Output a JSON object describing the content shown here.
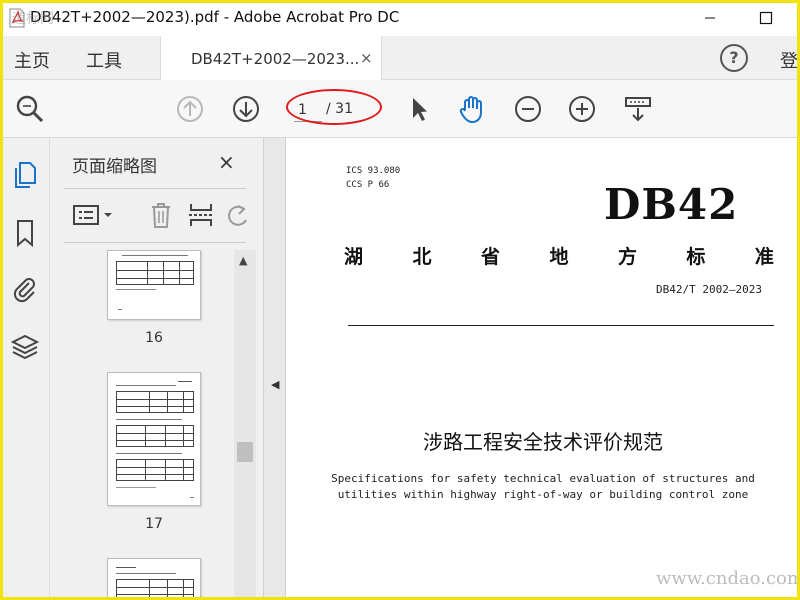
{
  "window": {
    "title": "DB42T+2002—2023).pdf - Adobe Acrobat Pro DC",
    "watermark_top": "道标网"
  },
  "tabbar": {
    "home": "主页",
    "tools": "工具",
    "doc_tab": "DB42T+2002—2023...",
    "close": "×",
    "help": "?",
    "signin": "登"
  },
  "toolbar": {
    "page_current": "1",
    "page_total": "/ 31",
    "icons": [
      "search-zoom-icon",
      "arrow-up-circle-icon",
      "arrow-down-circle-icon",
      "select-pointer-icon",
      "hand-tool-icon",
      "zoom-out-icon",
      "zoom-in-icon",
      "more-tools-icon"
    ],
    "highlight_color": "#e01a1a",
    "hand_color": "#1a73c9"
  },
  "thumb_panel": {
    "title": "页面缩略图",
    "close": "×",
    "thumbnails": [
      {
        "label": "16"
      },
      {
        "label": "17"
      },
      {
        "label": ""
      }
    ]
  },
  "document": {
    "ics": "ICS 93.080\nCCS P 66",
    "code": "DB42",
    "standard_type": [
      "湖",
      "北",
      "省",
      "地",
      "方",
      "标",
      "准"
    ],
    "standard_number": "DB42/T 2002—2023",
    "title": "涉路工程安全技术评价规范",
    "subtitle": "Specifications for safety technical evaluation of structures and utilities within highway right-of-way or building control zone"
  },
  "watermark": "www.cndao.com",
  "colors": {
    "frame": "#f2e20a",
    "panel_bg": "#f0f0f0",
    "accent_blue": "#1a73c9"
  }
}
